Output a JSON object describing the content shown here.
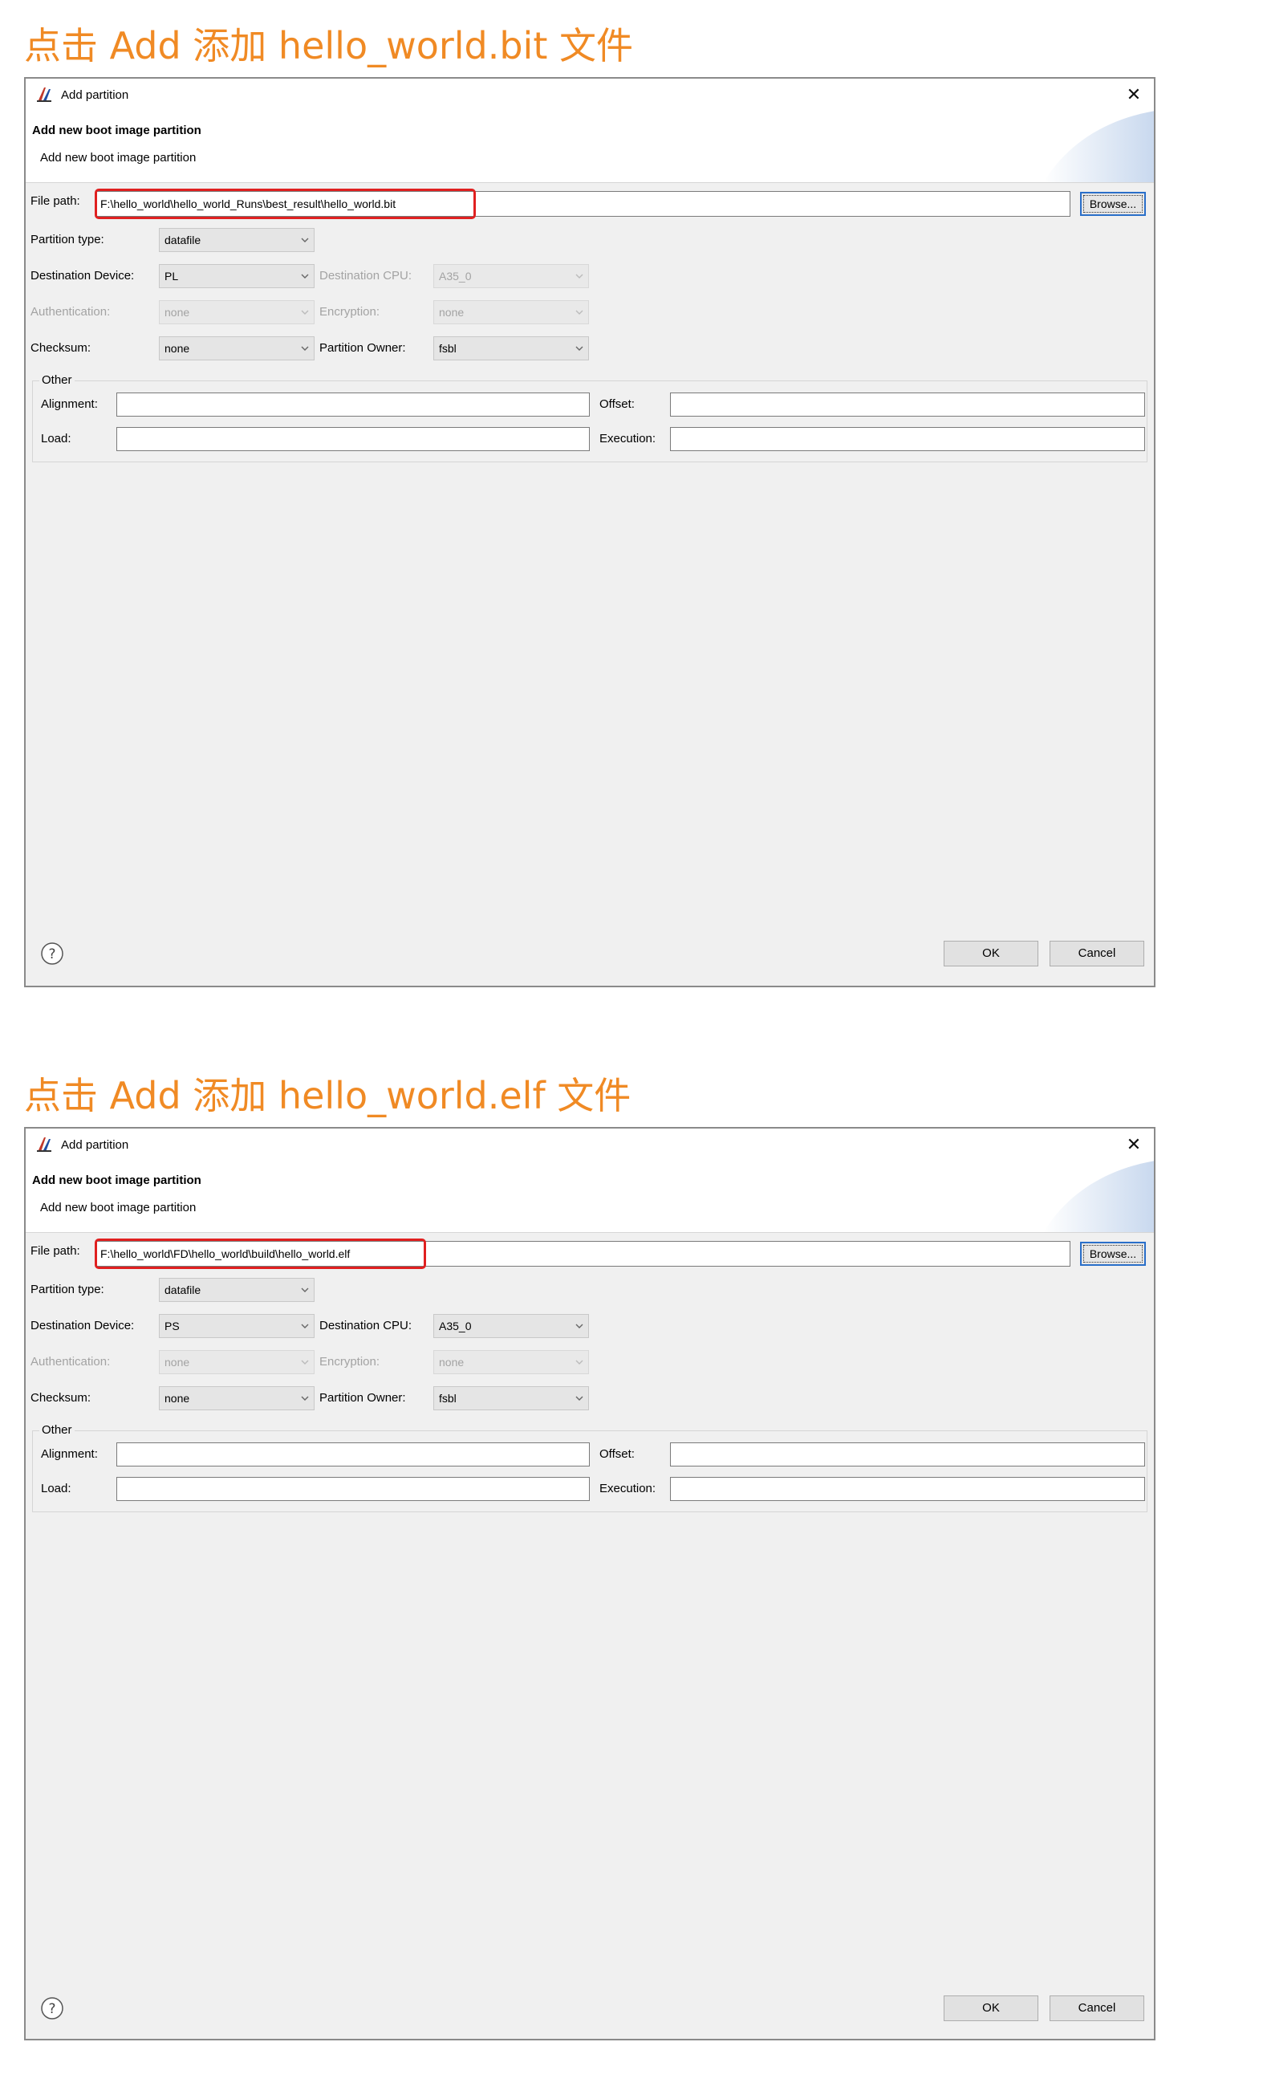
{
  "sections": [
    {
      "caption": "点击 Add 添加 hello_world.bit 文件",
      "dialog": {
        "title": "Add partition",
        "header_title": "Add new boot image partition",
        "header_desc": "Add new boot image partition",
        "file_path_label": "File path:",
        "file_path_value": "F:\\hello_world\\hello_world_Runs\\best_result\\hello_world.bit",
        "browse_label": "Browse...",
        "partition_type_label": "Partition type:",
        "partition_type_value": "datafile",
        "destination_device_label": "Destination Device:",
        "destination_device_value": "PL",
        "destination_cpu_label": "Destination CPU:",
        "destination_cpu_value": "A35_0",
        "authentication_label": "Authentication:",
        "authentication_value": "none",
        "encryption_label": "Encryption:",
        "encryption_value": "none",
        "checksum_label": "Checksum:",
        "checksum_value": "none",
        "partition_owner_label": "Partition Owner:",
        "partition_owner_value": "fsbl",
        "other_group_label": "Other",
        "alignment_label": "Alignment:",
        "offset_label": "Offset:",
        "load_label": "Load:",
        "execution_label": "Execution:",
        "ok_label": "OK",
        "cancel_label": "Cancel"
      }
    },
    {
      "caption": "点击 Add 添加 hello_world.elf 文件",
      "dialog": {
        "title": "Add partition",
        "header_title": "Add new boot image partition",
        "header_desc": "Add new boot image partition",
        "file_path_label": "File path:",
        "file_path_value": "F:\\hello_world\\FD\\hello_world\\build\\hello_world.elf",
        "browse_label": "Browse...",
        "partition_type_label": "Partition type:",
        "partition_type_value": "datafile",
        "destination_device_label": "Destination Device:",
        "destination_device_value": "PS",
        "destination_cpu_label": "Destination CPU:",
        "destination_cpu_value": "A35_0",
        "authentication_label": "Authentication:",
        "authentication_value": "none",
        "encryption_label": "Encryption:",
        "encryption_value": "none",
        "checksum_label": "Checksum:",
        "checksum_value": "none",
        "partition_owner_label": "Partition Owner:",
        "partition_owner_value": "fsbl",
        "other_group_label": "Other",
        "alignment_label": "Alignment:",
        "offset_label": "Offset:",
        "load_label": "Load:",
        "execution_label": "Execution:",
        "ok_label": "OK",
        "cancel_label": "Cancel"
      }
    }
  ],
  "colors": {
    "caption": "#f08a24",
    "highlight_box": "#e02020",
    "dialog_bg": "#f0f0f0",
    "disabled_text": "#a3a3a3"
  },
  "icons": {
    "app": "app-logo-icon",
    "close": "close-icon",
    "dropdown": "chevron-down-icon",
    "help": "help-icon"
  }
}
